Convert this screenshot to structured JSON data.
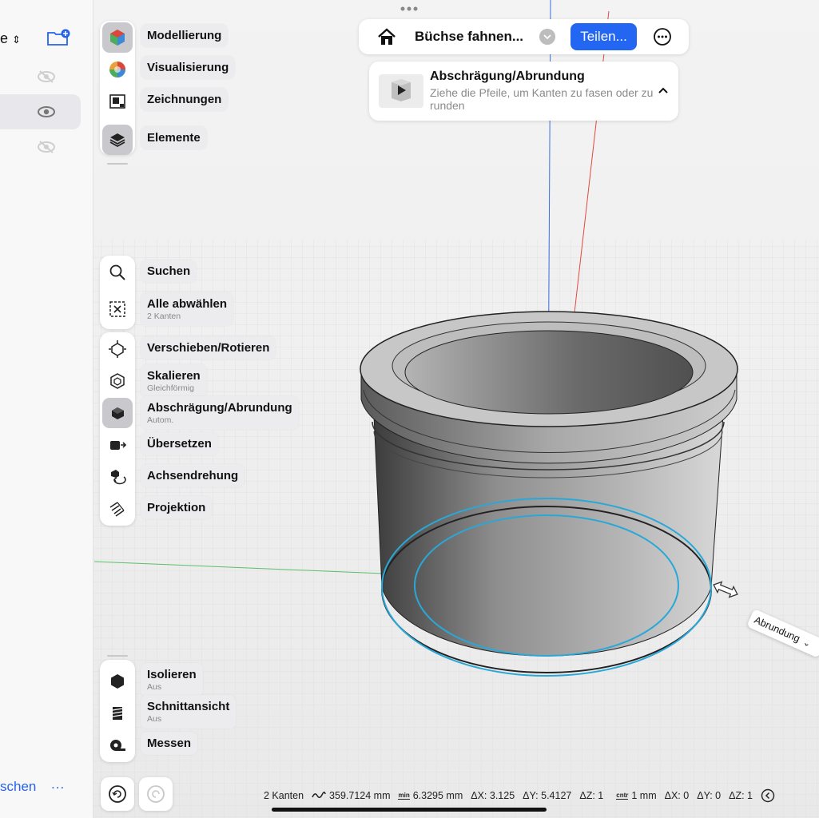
{
  "header": {
    "doc_title": "Büchse fahnen...",
    "share_label": "Teilen...",
    "home_icon": "house-icon",
    "more_icon": "ellipsis-circle-icon"
  },
  "tip": {
    "title": "Abschrägung/Abrundung",
    "text": "Ziehe die Pfeile, um Kanten zu fasen oder zu runden"
  },
  "sidepanel": {
    "sort_label": "e",
    "footer_search": "schen",
    "footer_more": "..."
  },
  "workspaces": [
    {
      "label": "Modellierung",
      "active": true
    },
    {
      "label": "Visualisierung",
      "active": false
    },
    {
      "label": "Zeichnungen",
      "active": false
    },
    {
      "label": "Elemente",
      "active": true
    }
  ],
  "tools": {
    "search": {
      "label": "Suchen"
    },
    "deselect": {
      "label": "Alle abwählen",
      "sub": "2 Kanten"
    },
    "move": {
      "label": "Verschieben/Rotieren"
    },
    "scale": {
      "label": "Skalieren",
      "sub": "Gleichförmig"
    },
    "fillet": {
      "label": "Abschrägung/Abrundung",
      "sub": "Autom."
    },
    "translate": {
      "label": "Übersetzen"
    },
    "axis": {
      "label": "Achsendrehung"
    },
    "project": {
      "label": "Projektion"
    },
    "isolate": {
      "label": "Isolieren",
      "sub": "Aus"
    },
    "section": {
      "label": "Schnittansicht",
      "sub": "Aus"
    },
    "measure": {
      "label": "Messen"
    }
  },
  "viewport": {
    "fillet_tag": "Abrundung"
  },
  "status": {
    "edges": "2 Kanten",
    "length": "359.7124 mm",
    "min_label": "min",
    "min_value": "6.3295 mm",
    "min_dx": "ΔX: 3.125",
    "min_dy": "ΔY: 5.4127",
    "min_dz": "ΔZ: 1",
    "cntr_label": "cntr",
    "cntr_value": "1 mm",
    "cntr_dx": "ΔX: 0",
    "cntr_dy": "ΔY: 0",
    "cntr_dz": "ΔZ: 1"
  },
  "colors": {
    "accent": "#2266f2",
    "selection": "#29a8d8",
    "x_axis": "#e04a3a",
    "z_axis": "#3a6fe0",
    "y_axis": "#5bbf6a"
  }
}
